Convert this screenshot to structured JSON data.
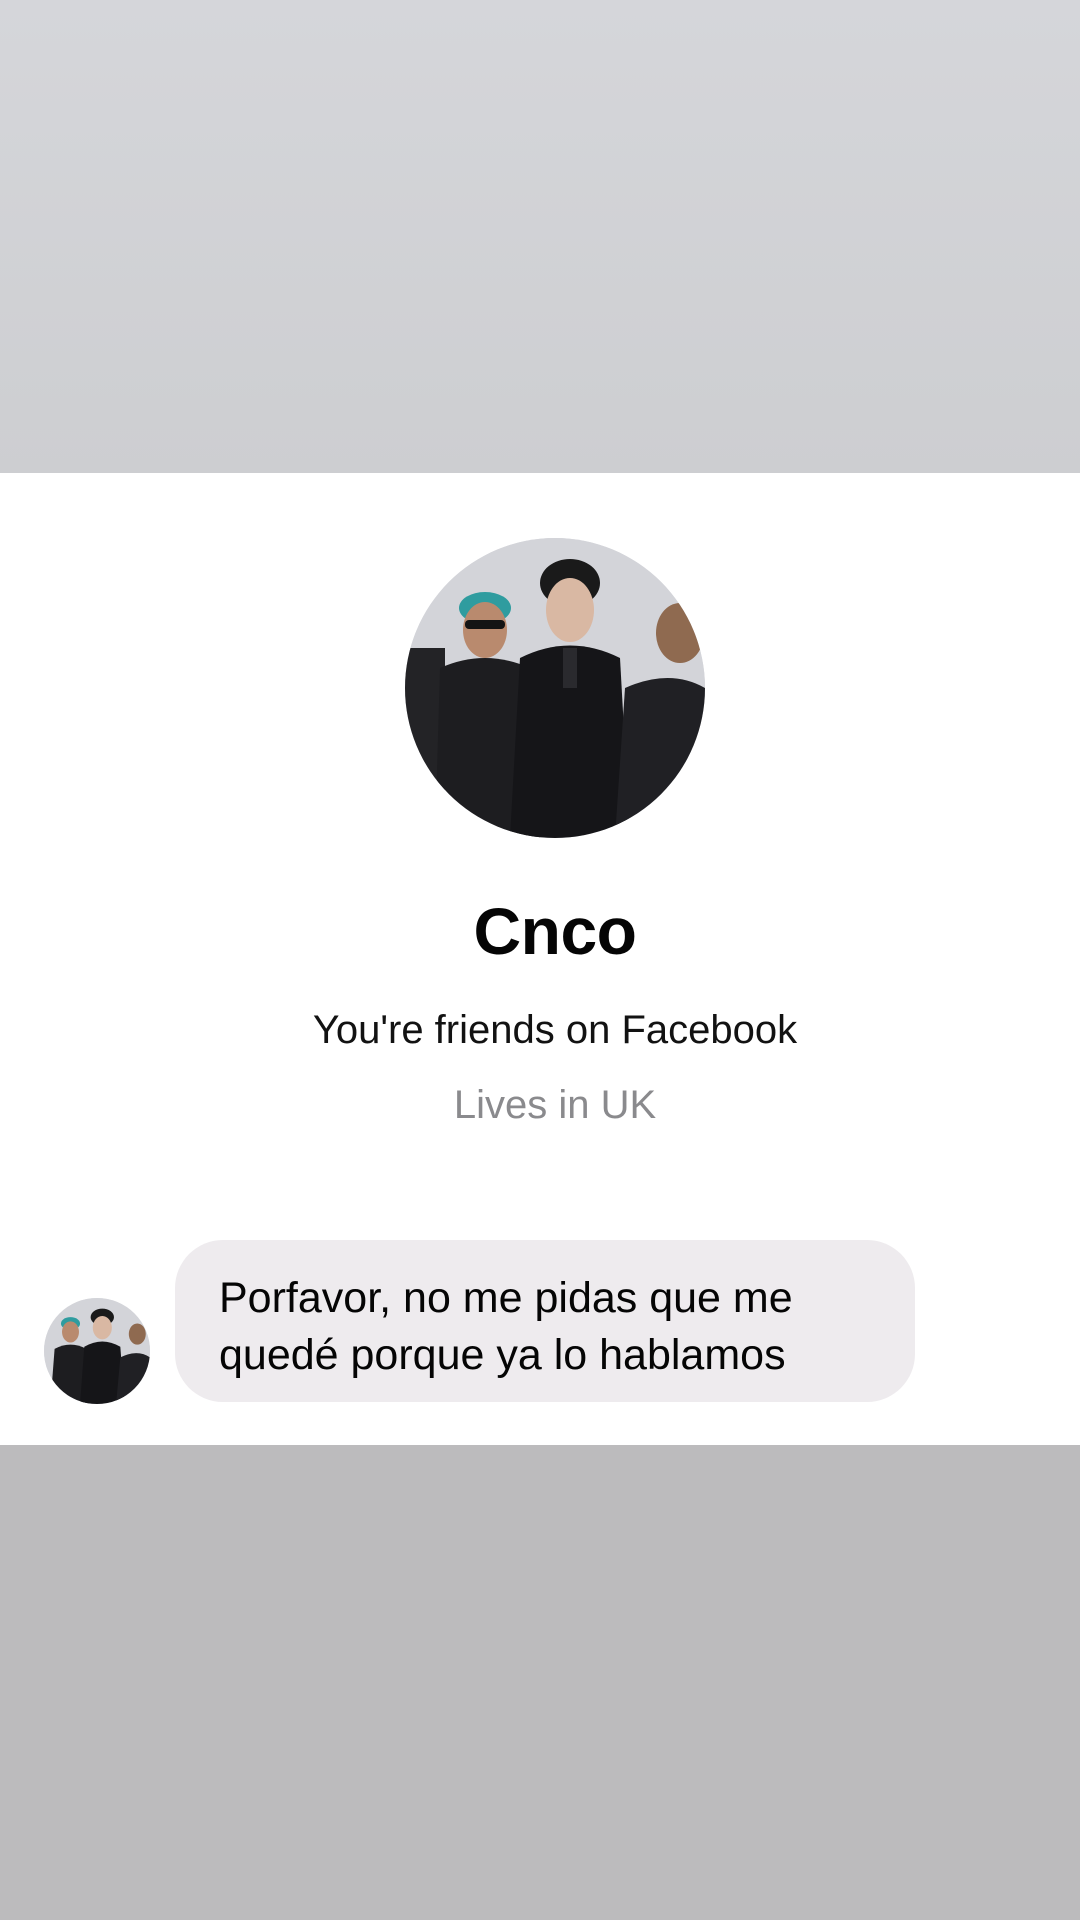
{
  "profile": {
    "name": "Cnco",
    "friend_status": "You're friends on Facebook",
    "location": "Lives in UK"
  },
  "message": {
    "lines": [
      "Porfavor, no me pidas que me",
      "quedé porque ya lo hablamos"
    ]
  },
  "colors": {
    "top_overlay": "#d5d6da",
    "bottom_overlay": "#bcbbbd",
    "bubble": "#eeebee",
    "secondary_text": "#8a8a8d"
  }
}
